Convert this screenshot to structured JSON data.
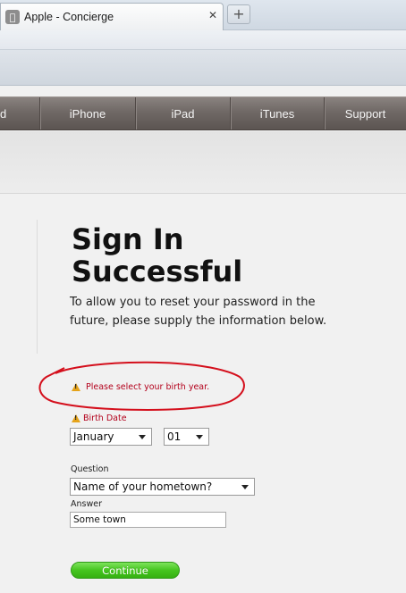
{
  "browser": {
    "tab_title": "Apple - Concierge",
    "tab_close": "✕",
    "new_tab": "+",
    "favicon": "apple-icon"
  },
  "nav": {
    "items": [
      {
        "label": "d"
      },
      {
        "label": "iPhone"
      },
      {
        "label": "iPad"
      },
      {
        "label": "iTunes"
      },
      {
        "label": "Support"
      }
    ]
  },
  "page": {
    "title_line1": "Sign In",
    "title_line2": "Successful",
    "intro": "To allow you to reset your password in the future, please supply the information below."
  },
  "form": {
    "error_message": "Please select your birth year.",
    "birth_date_label": "Birth Date",
    "birth_month": "January",
    "birth_day": "01",
    "question_label": "Question",
    "question_value": "Name of your hometown?",
    "answer_label": "Answer",
    "answer_value": "Some town",
    "continue_label": "Continue"
  },
  "colors": {
    "error_red": "#b3001b",
    "continue_green": "#45c51f",
    "annotation_red": "#d40f1c"
  }
}
